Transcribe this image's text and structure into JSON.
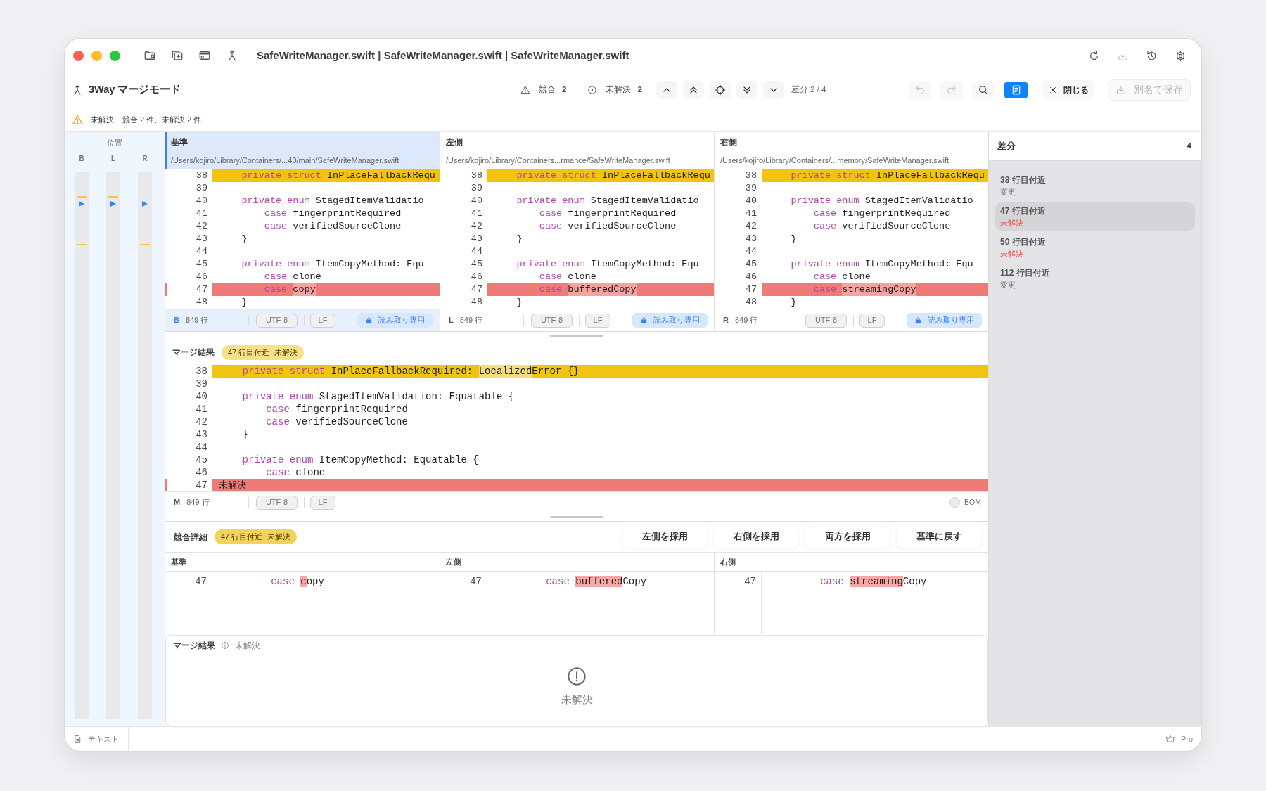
{
  "title_bar": {
    "tools": [
      {
        "kind": "folder"
      },
      {
        "kind": "window-plus"
      },
      {
        "kind": "panel"
      },
      {
        "kind": "merge"
      }
    ],
    "title": "SafeWriteManager.swift | SafeWriteManager.swift | SafeWriteManager.swift",
    "actions": [
      {
        "kind": "reload",
        "disabled": false
      },
      {
        "kind": "export",
        "disabled": true
      },
      {
        "kind": "history",
        "disabled": false
      },
      {
        "kind": "settings",
        "disabled": false
      }
    ]
  },
  "toolbar": {
    "mode": "3Way マージモード",
    "counters": [
      {
        "kind": "conflict",
        "label": "競合",
        "count": "2"
      },
      {
        "kind": "unresolved",
        "label": "未解決",
        "count": "2"
      }
    ],
    "navigation": [
      {
        "kind": "chevron-up"
      },
      {
        "kind": "double-chevron-up"
      },
      {
        "kind": "crosshair"
      },
      {
        "kind": "double-chevron-down"
      },
      {
        "kind": "chevron-down"
      }
    ],
    "diff_position": "差分 2 / 4",
    "actions": [
      {
        "kind": "undo",
        "disabled": true,
        "selected": false
      },
      {
        "kind": "redo",
        "disabled": true,
        "selected": false
      },
      {
        "kind": "search",
        "disabled": false,
        "selected": false
      },
      {
        "kind": "inspector",
        "disabled": false,
        "selected": true
      }
    ],
    "close_label": "閉じる",
    "save_as": {
      "label": "別名で保存",
      "disabled": true
    }
  },
  "banner": {
    "status": "未解決",
    "message": "競合 2 件、未解決 2 件"
  },
  "position_ruler": {
    "title": "位置",
    "tracks": [
      "B",
      "L",
      "R"
    ]
  },
  "panes": [
    {
      "title": "基準",
      "path": "/Users/kojiro/Library/Containers/...40/main/SafeWriteManager.swift",
      "selected": true,
      "tag": "B",
      "line_count": "849 行",
      "encoding": "UTF-8",
      "line_ending": "LF",
      "access": "読み取り専用",
      "lines": [
        {
          "number": "38",
          "kind": "changed",
          "segments": [
            {
              "text": "    private struct",
              "kind": "keyword"
            },
            {
              "text": " InPlaceFallbackRequ",
              "kind": "plain"
            }
          ]
        },
        {
          "number": "39",
          "kind": "plain"
        },
        {
          "number": "40",
          "kind": "plain",
          "segments": [
            {
              "text": "    private enum",
              "kind": "keyword"
            },
            {
              "text": " StagedItemValidatio",
              "kind": "plain"
            }
          ]
        },
        {
          "number": "41",
          "kind": "plain",
          "segments": [
            {
              "text": "        case",
              "kind": "keyword"
            },
            {
              "text": " fingerprintRequired",
              "kind": "plain"
            }
          ]
        },
        {
          "number": "42",
          "kind": "plain",
          "segments": [
            {
              "text": "        case",
              "kind": "keyword"
            },
            {
              "text": " verifiedSourceClone",
              "kind": "plain"
            }
          ]
        },
        {
          "number": "43",
          "kind": "plain",
          "segments": [
            {
              "text": "    }",
              "kind": "plain"
            }
          ]
        },
        {
          "number": "44",
          "kind": "plain"
        },
        {
          "number": "45",
          "kind": "plain",
          "segments": [
            {
              "text": "    private enum",
              "kind": "keyword"
            },
            {
              "text": " ItemCopyMethod: Equ",
              "kind": "plain"
            }
          ]
        },
        {
          "number": "46",
          "kind": "plain",
          "segments": [
            {
              "text": "        case",
              "kind": "keyword"
            },
            {
              "text": " clone",
              "kind": "plain"
            }
          ]
        },
        {
          "number": "47",
          "kind": "conflict",
          "segments": [
            {
              "text": "        case ",
              "kind": "keyword"
            },
            {
              "text": "copy",
              "kind": "diff"
            }
          ]
        },
        {
          "number": "48",
          "kind": "plain",
          "segments": [
            {
              "text": "    }",
              "kind": "plain"
            }
          ]
        }
      ]
    },
    {
      "title": "左側",
      "path": "/Users/kojiro/Library/Containers...rmance/SafeWriteManager.swift",
      "selected": false,
      "tag": "L",
      "line_count": "849 行",
      "encoding": "UTF-8",
      "line_ending": "LF",
      "access": "読み取り専用",
      "lines": [
        {
          "number": "38",
          "kind": "changed",
          "segments": [
            {
              "text": "    private struct",
              "kind": "keyword"
            },
            {
              "text": " InPlaceFallbackRequ",
              "kind": "plain"
            }
          ]
        },
        {
          "number": "39",
          "kind": "plain"
        },
        {
          "number": "40",
          "kind": "plain",
          "segments": [
            {
              "text": "    private enum",
              "kind": "keyword"
            },
            {
              "text": " StagedItemValidatio",
              "kind": "plain"
            }
          ]
        },
        {
          "number": "41",
          "kind": "plain",
          "segments": [
            {
              "text": "        case",
              "kind": "keyword"
            },
            {
              "text": " fingerprintRequired",
              "kind": "plain"
            }
          ]
        },
        {
          "number": "42",
          "kind": "plain",
          "segments": [
            {
              "text": "        case",
              "kind": "keyword"
            },
            {
              "text": " verifiedSourceClone",
              "kind": "plain"
            }
          ]
        },
        {
          "number": "43",
          "kind": "plain",
          "segments": [
            {
              "text": "    }",
              "kind": "plain"
            }
          ]
        },
        {
          "number": "44",
          "kind": "plain"
        },
        {
          "number": "45",
          "kind": "plain",
          "segments": [
            {
              "text": "    private enum",
              "kind": "keyword"
            },
            {
              "text": " ItemCopyMethod: Equ",
              "kind": "plain"
            }
          ]
        },
        {
          "number": "46",
          "kind": "plain",
          "segments": [
            {
              "text": "        case",
              "kind": "keyword"
            },
            {
              "text": " clone",
              "kind": "plain"
            }
          ]
        },
        {
          "number": "47",
          "kind": "conflict",
          "segments": [
            {
              "text": "        case ",
              "kind": "keyword"
            },
            {
              "text": "bufferedCopy",
              "kind": "diff"
            }
          ]
        },
        {
          "number": "48",
          "kind": "plain",
          "segments": [
            {
              "text": "    }",
              "kind": "plain"
            }
          ]
        }
      ]
    },
    {
      "title": "右側",
      "path": "/Users/kojiro/Library/Containers/...memory/SafeWriteManager.swift",
      "selected": false,
      "tag": "R",
      "line_count": "849 行",
      "encoding": "UTF-8",
      "line_ending": "LF",
      "access": "読み取り専用",
      "lines": [
        {
          "number": "38",
          "kind": "changed",
          "segments": [
            {
              "text": "    private struct",
              "kind": "keyword"
            },
            {
              "text": " InPlaceFallbackRequ",
              "kind": "plain"
            }
          ]
        },
        {
          "number": "39",
          "kind": "plain"
        },
        {
          "number": "40",
          "kind": "plain",
          "segments": [
            {
              "text": "    private enum",
              "kind": "keyword"
            },
            {
              "text": " StagedItemValidatio",
              "kind": "plain"
            }
          ]
        },
        {
          "number": "41",
          "kind": "plain",
          "segments": [
            {
              "text": "        case",
              "kind": "keyword"
            },
            {
              "text": " fingerprintRequired",
              "kind": "plain"
            }
          ]
        },
        {
          "number": "42",
          "kind": "plain",
          "segments": [
            {
              "text": "        case",
              "kind": "keyword"
            },
            {
              "text": " verifiedSourceClone",
              "kind": "plain"
            }
          ]
        },
        {
          "number": "43",
          "kind": "plain",
          "segments": [
            {
              "text": "    }",
              "kind": "plain"
            }
          ]
        },
        {
          "number": "44",
          "kind": "plain"
        },
        {
          "number": "45",
          "kind": "plain",
          "segments": [
            {
              "text": "    private enum",
              "kind": "keyword"
            },
            {
              "text": " ItemCopyMethod: Equ",
              "kind": "plain"
            }
          ]
        },
        {
          "number": "46",
          "kind": "plain",
          "segments": [
            {
              "text": "        case",
              "kind": "keyword"
            },
            {
              "text": " clone",
              "kind": "plain"
            }
          ]
        },
        {
          "number": "47",
          "kind": "conflict",
          "segments": [
            {
              "text": "        case ",
              "kind": "keyword"
            },
            {
              "text": "streamingCopy",
              "kind": "diff"
            }
          ]
        },
        {
          "number": "48",
          "kind": "plain",
          "segments": [
            {
              "text": "    }",
              "kind": "plain"
            }
          ]
        }
      ]
    }
  ],
  "merge": {
    "title": "マージ結果",
    "badge": {
      "location": "47 行目付近",
      "status": "未解決"
    },
    "lines": [
      {
        "number": "38",
        "kind": "changed",
        "segments": [
          {
            "text": "    private struct",
            "kind": "keyword"
          },
          {
            "text": " InPlaceFallbackRequired: ",
            "kind": "plain"
          },
          {
            "text": "Localized",
            "kind": "diff"
          },
          {
            "text": "Error {}",
            "kind": "plain"
          }
        ]
      },
      {
        "number": "39",
        "kind": "plain"
      },
      {
        "number": "40",
        "kind": "plain",
        "segments": [
          {
            "text": "    private enum",
            "kind": "keyword"
          },
          {
            "text": " StagedItemValidation: Equatable {",
            "kind": "plain"
          }
        ]
      },
      {
        "number": "41",
        "kind": "plain",
        "segments": [
          {
            "text": "        case",
            "kind": "keyword"
          },
          {
            "text": " fingerprintRequired",
            "kind": "plain"
          }
        ]
      },
      {
        "number": "42",
        "kind": "plain",
        "segments": [
          {
            "text": "        case",
            "kind": "keyword"
          },
          {
            "text": " verifiedSourceClone",
            "kind": "plain"
          }
        ]
      },
      {
        "number": "43",
        "kind": "plain",
        "segments": [
          {
            "text": "    }",
            "kind": "plain"
          }
        ]
      },
      {
        "number": "44",
        "kind": "plain"
      },
      {
        "number": "45",
        "kind": "plain",
        "segments": [
          {
            "text": "    private enum",
            "kind": "keyword"
          },
          {
            "text": " ItemCopyMethod: Equatable {",
            "kind": "plain"
          }
        ]
      },
      {
        "number": "46",
        "kind": "plain",
        "segments": [
          {
            "text": "        case",
            "kind": "keyword"
          },
          {
            "text": " clone",
            "kind": "plain"
          }
        ]
      },
      {
        "number": "47",
        "kind": "conflict",
        "segments": [
          {
            "text": "未解決",
            "kind": "label"
          }
        ]
      }
    ],
    "tag": "M",
    "line_count": "849 行",
    "encoding": "UTF-8",
    "line_ending": "LF",
    "bom": {
      "label": "BOM",
      "checked": false
    }
  },
  "conflict_detail": {
    "title": "競合詳細",
    "badge": {
      "location": "47 行目付近",
      "status": "未解決"
    },
    "buttons": [
      "左側を採用",
      "右側を採用",
      "両方を採用",
      "基準に戻す"
    ],
    "columns": [
      {
        "title": "基準",
        "number": "47",
        "segments": [
          {
            "text": "        case ",
            "kind": "keyword"
          },
          {
            "text": "c",
            "kind": "diff"
          },
          {
            "text": "opy",
            "kind": "plain"
          }
        ]
      },
      {
        "title": "左側",
        "number": "47",
        "segments": [
          {
            "text": "        case ",
            "kind": "keyword"
          },
          {
            "text": "buffered",
            "kind": "diff"
          },
          {
            "text": "Copy",
            "kind": "plain"
          }
        ]
      },
      {
        "title": "右側",
        "number": "47",
        "segments": [
          {
            "text": "        case ",
            "kind": "keyword"
          },
          {
            "text": "streaming",
            "kind": "diff"
          },
          {
            "text": "Copy",
            "kind": "plain"
          }
        ]
      }
    ],
    "result": {
      "title": "マージ結果",
      "status": "未解決",
      "message": "未解決"
    }
  },
  "sidebar": {
    "title": "差分",
    "count": "4",
    "items": [
      {
        "location": "38 行目付近",
        "status": "変更",
        "kind": "changed",
        "selected": false
      },
      {
        "location": "47 行目付近",
        "status": "未解決",
        "kind": "unresolved",
        "selected": true
      },
      {
        "location": "50 行目付近",
        "status": "未解決",
        "kind": "unresolved",
        "selected": false
      },
      {
        "location": "112 行目付近",
        "status": "変更",
        "kind": "changed",
        "selected": false
      }
    ]
  },
  "status_bar": {
    "mode": "テキスト",
    "plan": "Pro"
  }
}
